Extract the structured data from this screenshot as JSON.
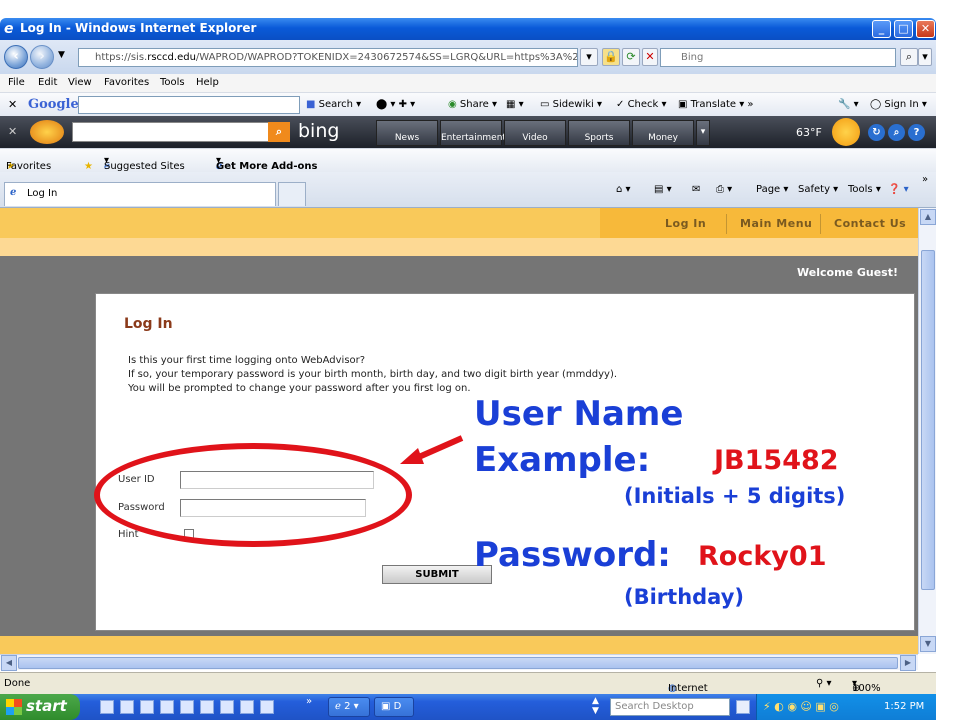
{
  "window": {
    "title": "Log In - Windows Internet Explorer"
  },
  "address_bar": {
    "url_prefix": "https://sis.",
    "url_host": "rsccd.edu",
    "url_path": "/WAPROD/WAPROD?TOKENIDX=2430672574&SS=LGRQ&URL=https%3A%2F%2F",
    "search_placeholder": "Bing"
  },
  "menu": [
    "File",
    "Edit",
    "View",
    "Favorites",
    "Tools",
    "Help"
  ],
  "google_toolbar": {
    "logo": "Google",
    "items": [
      "Search",
      "Share",
      "Sidewiki",
      "Check",
      "Translate"
    ],
    "signin": "Sign In"
  },
  "bing_bar": {
    "logo": "bing",
    "tabs": [
      "News",
      "Entertainment",
      "Video",
      "Sports",
      "Money"
    ],
    "temperature": "63°F"
  },
  "favorites_bar": {
    "favorites": "Favorites",
    "suggested": "Suggested Sites",
    "addons": "Get More Add-ons"
  },
  "tabs": [
    {
      "label": "Log In"
    }
  ],
  "command_bar": {
    "page": "Page",
    "safety": "Safety",
    "tools": "Tools"
  },
  "site_nav": [
    "Log In",
    "Main Menu",
    "Contact Us"
  ],
  "welcome": "Welcome Guest!",
  "login": {
    "title": "Log In",
    "info_lines": [
      "Is this your first time logging onto WebAdvisor?",
      "If so, your temporary password is your birth month, birth day, and two digit birth year (mmddyy).",
      "You will be prompted to change your password after you first log on."
    ],
    "user_id_label": "User ID",
    "password_label": "Password",
    "hint_label": "Hint",
    "submit_label": "SUBMIT"
  },
  "annotation": {
    "user_name_heading": "User Name",
    "example_label": "Example:",
    "example_value": "JB15482",
    "example_note": "(Initials + 5 digits)",
    "password_label": "Password:",
    "password_value": "Rocky01",
    "password_note": "(Birthday)"
  },
  "status_bar": {
    "left": "Done",
    "zone": "Internet",
    "zoom": "100%"
  },
  "taskbar": {
    "start": "start",
    "ie_group": "2",
    "doc_task": "D",
    "search": "Search Desktop",
    "clock": "1:52 PM"
  },
  "colors": {
    "annotation_blue": "#1a3fd6",
    "annotation_red": "#e0131a",
    "nav_gold": "#f9c95a",
    "login_title": "#8b3a1a"
  }
}
